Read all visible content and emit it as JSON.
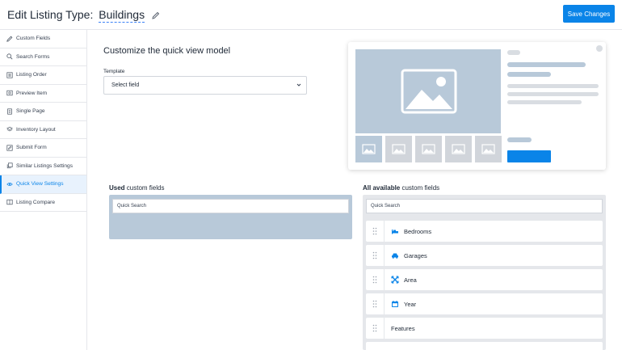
{
  "header": {
    "title_prefix": "Edit Listing Type:",
    "listing_type": "Buildings",
    "save_label": "Save Changes"
  },
  "sidebar": {
    "items": [
      {
        "label": "Custom Fields",
        "icon": "pencil-icon"
      },
      {
        "label": "Search Forms",
        "icon": "search-icon"
      },
      {
        "label": "Listing Order",
        "icon": "list-order-icon"
      },
      {
        "label": "Preview Item",
        "icon": "preview-icon"
      },
      {
        "label": "Single Page",
        "icon": "page-icon"
      },
      {
        "label": "Inventory Layout",
        "icon": "layers-icon"
      },
      {
        "label": "Submit Form",
        "icon": "edit-form-icon"
      },
      {
        "label": "Similar Listings Settings",
        "icon": "copy-icon"
      },
      {
        "label": "Quick View Settings",
        "icon": "eye-icon",
        "active": true
      },
      {
        "label": "Listing Compare",
        "icon": "compare-icon"
      }
    ]
  },
  "main": {
    "title": "Customize the quick view model",
    "template_label": "Template",
    "template_value": "Select field"
  },
  "used": {
    "label_bold": "Used",
    "label_rest": " custom fields",
    "search_value": "Quick Search"
  },
  "available": {
    "label_bold": "All available",
    "label_rest": " custom fields",
    "search_value": "Quick Search",
    "fields": [
      {
        "label": "Bedrooms",
        "icon": "bed-icon"
      },
      {
        "label": "Garages",
        "icon": "car-icon"
      },
      {
        "label": "Area",
        "icon": "expand-icon"
      },
      {
        "label": "Year",
        "icon": "calendar-icon"
      },
      {
        "label": "Features",
        "icon": ""
      }
    ]
  },
  "colors": {
    "accent": "#0a84e8",
    "placeholder": "#b8c9d9",
    "panel_grey": "#e5e7eb"
  }
}
